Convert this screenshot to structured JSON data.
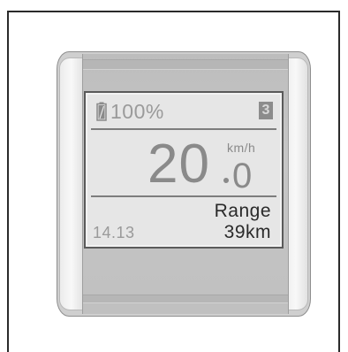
{
  "display": {
    "battery": {
      "percent_text": "100%",
      "level": 1.0
    },
    "assist_level": "3",
    "speed": {
      "integer": "20",
      "decimal": "0",
      "unit": "km/h"
    },
    "trip": "14.13",
    "range": {
      "label": "Range",
      "value": "39km"
    }
  },
  "icons": {
    "battery": "battery-icon"
  },
  "colors": {
    "shell": "#cfcfcf",
    "screen_bg": "#e6e6e6",
    "segment_text": "#8a8a8a",
    "dark_text": "#2a2a2a",
    "assist_badge": "#8c8c8c"
  }
}
